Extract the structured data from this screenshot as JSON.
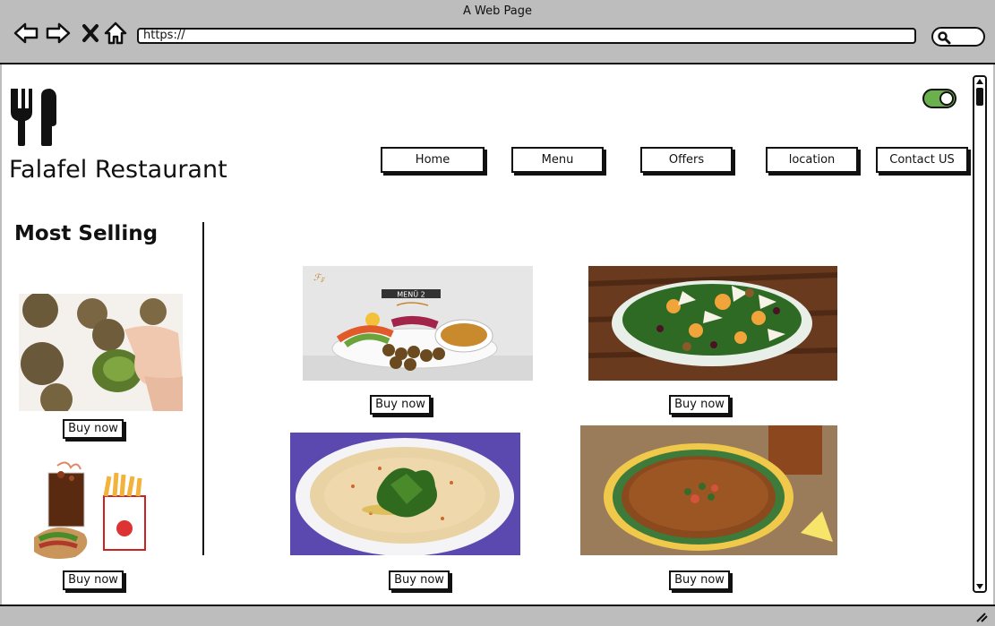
{
  "window": {
    "title": "A Web Page"
  },
  "browser": {
    "url": "https://"
  },
  "site": {
    "brand": "Falafel Restaurant"
  },
  "nav": {
    "items": [
      {
        "label": "Home"
      },
      {
        "label": "Menu"
      },
      {
        "label": "Offers"
      },
      {
        "label": "location"
      },
      {
        "label": "Contact US"
      }
    ]
  },
  "sidebar": {
    "title": "Most Selling"
  },
  "products": {
    "buy_label": "Buy now"
  },
  "menu_card": {
    "heading": "MENÜ 2"
  },
  "colors": {
    "toggle_on": "#6ab04c"
  },
  "icons": [
    "back-icon",
    "forward-icon",
    "close-icon",
    "home-icon",
    "search-icon",
    "fork-knife-icon",
    "toggle-switch",
    "resize-handle-icon"
  ]
}
